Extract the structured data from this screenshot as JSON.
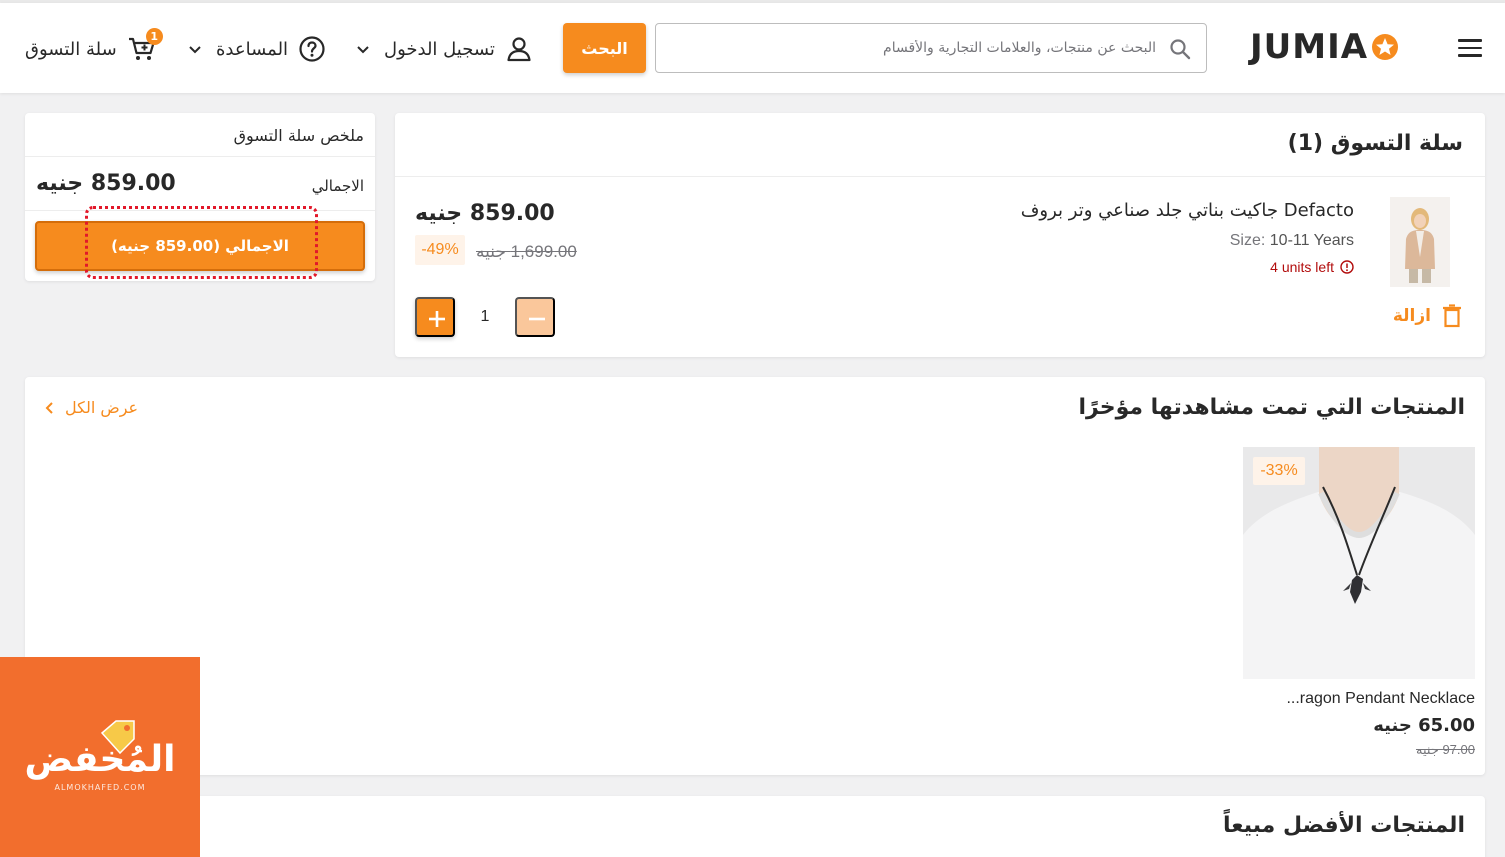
{
  "header": {
    "logo_text": "JUMIA",
    "search_placeholder": "البحث عن منتجات، والعلامات التجارية والأقسام",
    "search_button": "البحث",
    "account_label": "تسجيل الدخول",
    "help_label": "المساعدة",
    "cart_label": "سلة التسوق",
    "cart_count": "1"
  },
  "cart": {
    "title": "سلة التسوق (1)",
    "item": {
      "name": "Defacto جاكيت بناتي جلد صناعي وتر بروف",
      "size_label": "Size:",
      "size_value": "10-11 Years",
      "units_left": "4 units left",
      "price": "859.00 جنيه",
      "old_price": "1,699.00 جنيه",
      "discount": "-49%",
      "remove_label": "ازالة",
      "quantity": "1"
    }
  },
  "summary": {
    "title": "ملخص سلة التسوق",
    "total_label": "الاجمالي",
    "total_value": "859.00 جنيه",
    "checkout_button": "الاجمالي (859.00 جنيه)"
  },
  "recently_viewed": {
    "title": "المنتجات التي تمت مشاهدتها مؤخرًا",
    "see_all": "عرض الكل",
    "products": [
      {
        "name": "...ragon Pendant Necklace",
        "price": "65.00 جنيه",
        "old_price": "97.00 جنيه",
        "discount": "-33%"
      }
    ]
  },
  "best_sellers": {
    "title": "المنتجات الأفضل مبيعاً"
  },
  "watermark": {
    "text": "المُخفض",
    "sub": "ALMOKHAFED.COM"
  },
  "colors": {
    "accent": "#f68b1e",
    "warning": "#b20d0d",
    "highlight": "#e2182a"
  }
}
